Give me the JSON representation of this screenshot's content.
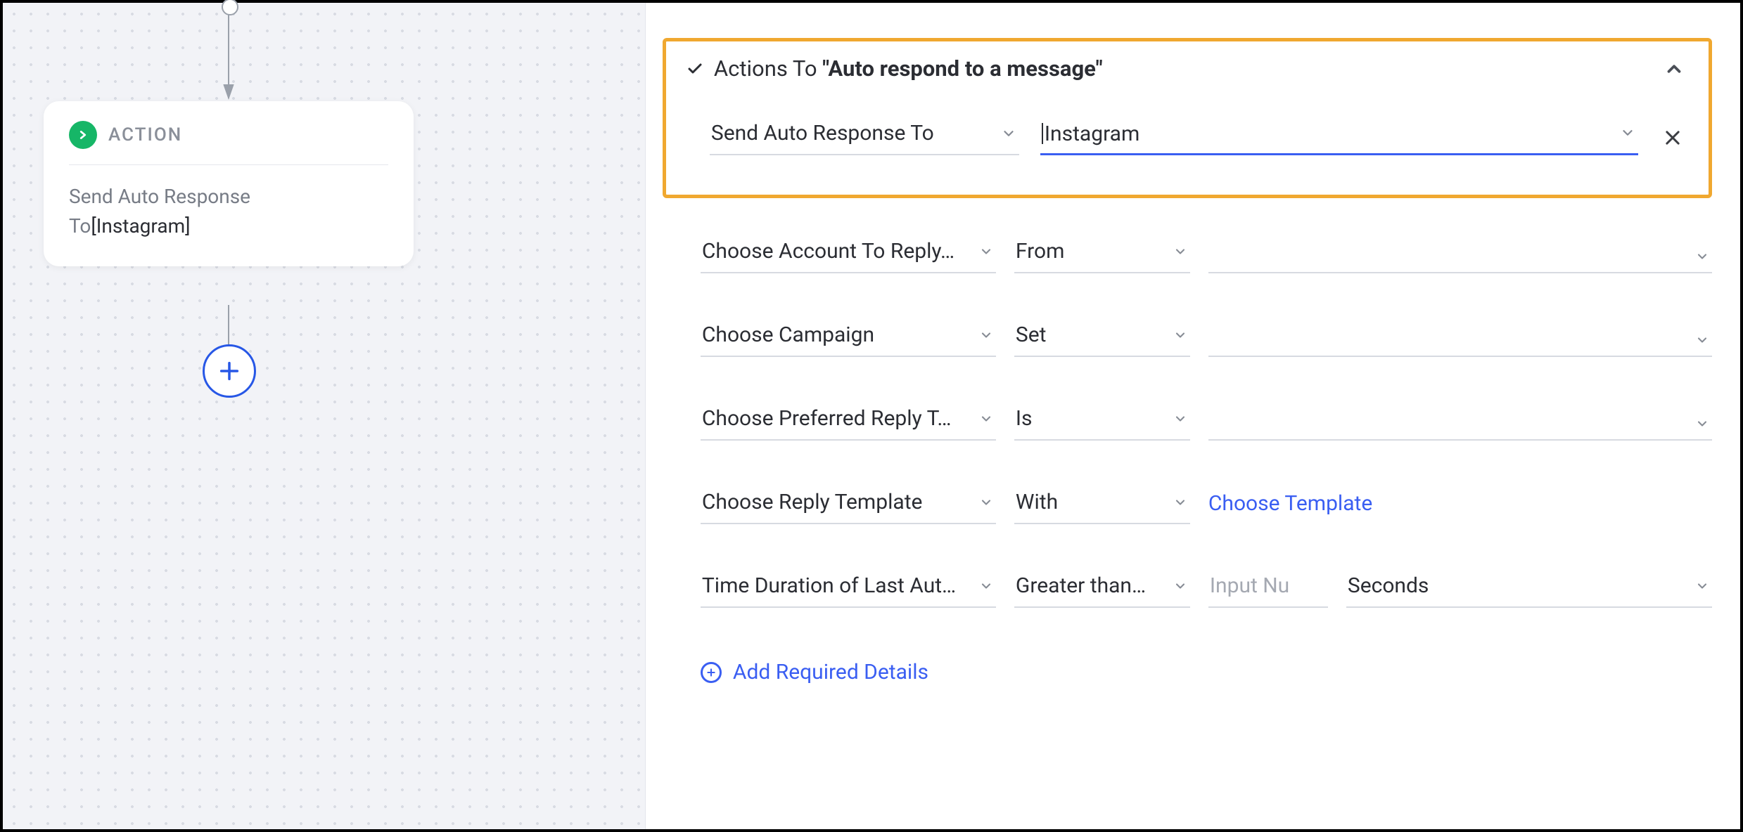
{
  "canvas": {
    "node": {
      "badge": "ACTION",
      "line1": "Send Auto Response",
      "line2_prefix": "To",
      "line2_value": "[Instagram]"
    }
  },
  "panel": {
    "header": {
      "prefix": "Actions To ",
      "quoted": "\"Auto respond to a message\""
    },
    "top": {
      "action_select": "Send Auto Response To",
      "value_input": "Instagram"
    },
    "rows": [
      {
        "field": "Choose Account To Reply…",
        "op": "From",
        "value": "",
        "value_ph": ""
      },
      {
        "field": "Choose Campaign",
        "op": "Set",
        "value": "",
        "value_ph": ""
      },
      {
        "field": "Choose Preferred Reply T…",
        "op": "Is",
        "value": "",
        "value_ph": ""
      },
      {
        "field": "Choose Reply Template",
        "op": "With",
        "value_link": "Choose Template"
      },
      {
        "field": "Time Duration of Last Aut…",
        "op": "Greater than…",
        "value": "",
        "value_ph": "Input Nu",
        "unit": "Seconds"
      }
    ],
    "add_details": "Add Required Details"
  }
}
